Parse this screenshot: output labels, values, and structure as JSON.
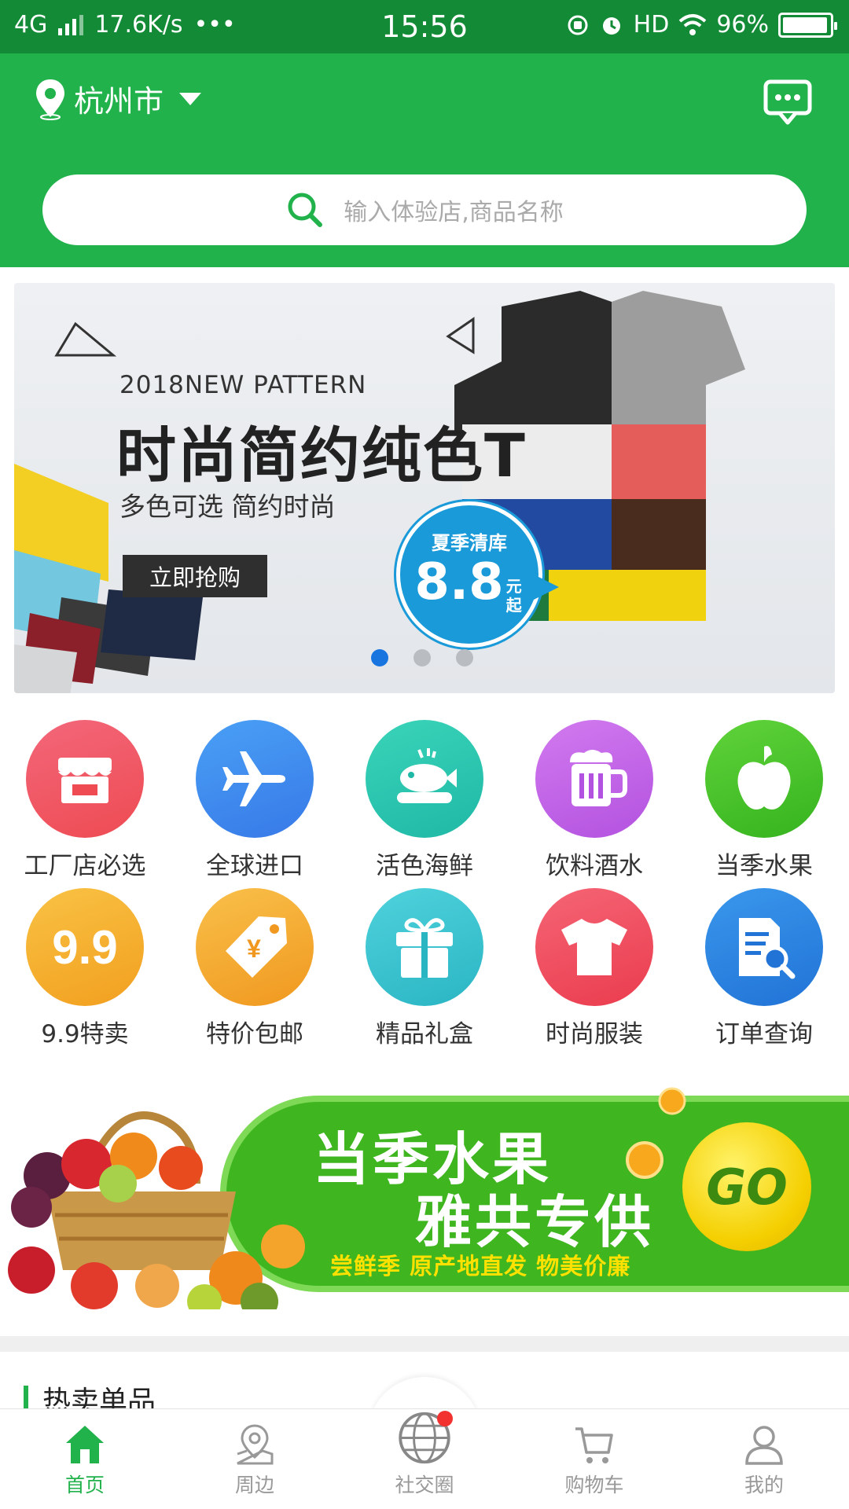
{
  "status_bar": {
    "network": "4G",
    "speed": "17.6K/s",
    "more": "•••",
    "time": "15:56",
    "hd": "HD",
    "battery": "96%",
    "battery_level": 0.96
  },
  "header": {
    "city": "杭州市",
    "search_placeholder": "输入体验店,商品名称"
  },
  "banner": {
    "subtitle_en": "2018NEW PATTERN",
    "headline": "时尚简约纯色T",
    "tagline": "多色可选 简约时尚",
    "cta": "立即抢购",
    "badge_label": "夏季清库",
    "badge_price": "8.8",
    "badge_unit": "元起",
    "slide_count": 3,
    "active_slide": 1
  },
  "categories": [
    {
      "label": "工厂店必选",
      "icon": "storefront-icon",
      "color": "#f0525f"
    },
    {
      "label": "全球进口",
      "icon": "airplane-icon",
      "color": "#3f8df0"
    },
    {
      "label": "活色海鲜",
      "icon": "seafood-icon",
      "color": "#2ec8b0"
    },
    {
      "label": "饮料酒水",
      "icon": "beer-mug-icon",
      "color": "#c466e8"
    },
    {
      "label": "当季水果",
      "icon": "apple-icon",
      "color": "#4cc42a"
    },
    {
      "label": "9.9特卖",
      "icon": "nine-nine-icon",
      "color": "#f6b12e"
    },
    {
      "label": "特价包邮",
      "icon": "price-tag-icon",
      "color": "#f5ae2e"
    },
    {
      "label": "精品礼盒",
      "icon": "gift-box-icon",
      "color": "#3cc3cf"
    },
    {
      "label": "时尚服装",
      "icon": "tshirt-icon",
      "color": "#f04e60"
    },
    {
      "label": "订单查询",
      "icon": "order-search-icon",
      "color": "#2d86e0"
    }
  ],
  "promo": {
    "line1": "当季水果",
    "line2": "雅共专供",
    "line3": "尝鲜季  原产地直发  物美价廉",
    "go": "GO"
  },
  "section": {
    "hot_title": "热卖单品"
  },
  "tabbar": [
    {
      "label": "首页",
      "icon": "home-icon",
      "active": true
    },
    {
      "label": "周边",
      "icon": "map-pin-icon",
      "active": false
    },
    {
      "label": "社交圈",
      "icon": "globe-icon",
      "active": false
    },
    {
      "label": "购物车",
      "icon": "cart-icon",
      "active": false
    },
    {
      "label": "我的",
      "icon": "user-icon",
      "active": false
    }
  ]
}
